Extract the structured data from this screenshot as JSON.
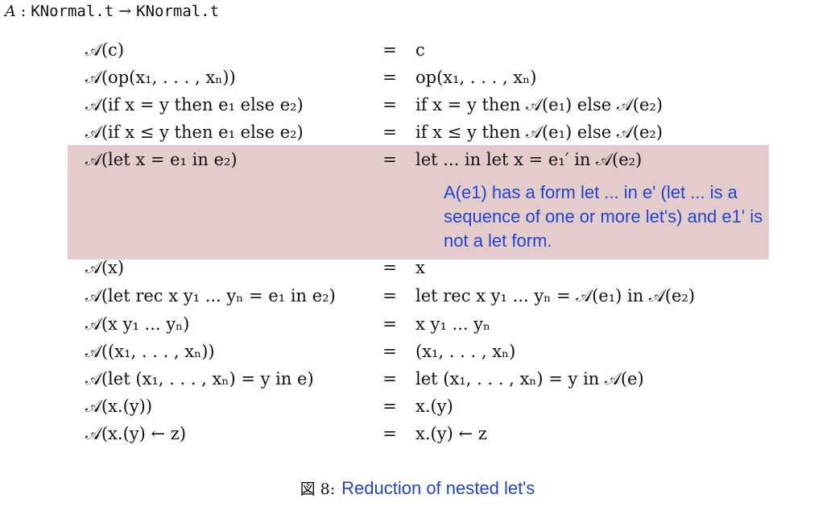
{
  "signature": {
    "name": "A",
    "colon": " : ",
    "domain": "KNormal.t",
    "arrow": " → ",
    "codomain": "KNormal.t"
  },
  "rows": [
    {
      "lhs": "𝒜(c)",
      "eq": "=",
      "rhs": "c"
    },
    {
      "lhs": "𝒜(op(x₁, . . . , xₙ))",
      "eq": "=",
      "rhs": "op(x₁, . . . , xₙ)"
    },
    {
      "lhs": "𝒜(if x = y then e₁ else e₂)",
      "eq": "=",
      "rhs": "if x = y then 𝒜(e₁) else 𝒜(e₂)"
    },
    {
      "lhs": "𝒜(if x ≤ y then e₁ else e₂)",
      "eq": "=",
      "rhs": "if x ≤ y then 𝒜(e₁) else 𝒜(e₂)"
    },
    {
      "lhs": "𝒜(let x = e₁ in e₂)",
      "eq": "=",
      "rhs": "let ... in let x = e₁′ in 𝒜(e₂)"
    },
    {
      "lhs": "𝒜(x)",
      "eq": "=",
      "rhs": "x"
    },
    {
      "lhs": "𝒜(let rec x y₁ ... yₙ = e₁ in e₂)",
      "eq": "=",
      "rhs": "let rec x y₁ ... yₙ = 𝒜(e₁) in 𝒜(e₂)"
    },
    {
      "lhs": "𝒜(x y₁ ... yₙ)",
      "eq": "=",
      "rhs": "x y₁ ... yₙ"
    },
    {
      "lhs": "𝒜((x₁, . . . , xₙ))",
      "eq": "=",
      "rhs": "(x₁, . . . , xₙ)"
    },
    {
      "lhs": "𝒜(let (x₁, . . . , xₙ) = y in e)",
      "eq": "=",
      "rhs": "let (x₁, . . . , xₙ) = y in 𝒜(e)"
    },
    {
      "lhs": "𝒜(x.(y))",
      "eq": "=",
      "rhs": "x.(y)"
    },
    {
      "lhs": "𝒜(x.(y) ← z)",
      "eq": "=",
      "rhs": "x.(y) ← z"
    }
  ],
  "annotation": "A(e1) has a form let ... in e' (let ... is a sequence of one or more let's) and e1' is not a let form.",
  "caption": {
    "label": "図 8:",
    "title": "Reduction of nested let's"
  },
  "colors": {
    "highlight": "#e4cccc",
    "annotation_text": "#2244cc"
  }
}
